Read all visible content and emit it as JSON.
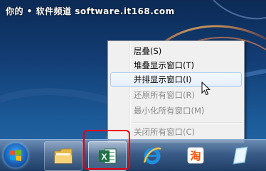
{
  "desktop": {
    "watermark": "你的 • 软件频道 software.it168.com"
  },
  "context_menu": {
    "items": [
      {
        "label": "层叠(S)",
        "state": "normal"
      },
      {
        "label": "堆叠显示窗口(T)",
        "state": "normal"
      },
      {
        "label": "并排显示窗口(I)",
        "state": "hover"
      },
      {
        "label": "还原所有窗口(R)",
        "state": "disabled"
      },
      {
        "label": "最小化所有窗口(M)",
        "state": "disabled"
      },
      {
        "label": "关闭所有窗口(C)",
        "state": "disabled"
      }
    ]
  },
  "taskbar": {
    "buttons": [
      {
        "name": "start-orb",
        "icon": "windows-logo-icon"
      },
      {
        "name": "explorer",
        "icon": "folder-icon"
      },
      {
        "name": "excel",
        "icon": "excel-icon"
      },
      {
        "name": "internet-explorer",
        "icon": "ie-icon"
      },
      {
        "name": "taobao",
        "icon": "taobao-icon",
        "glyph": "淘"
      },
      {
        "name": "notepad",
        "icon": "notepad-icon"
      }
    ],
    "excel_glyph": "X"
  },
  "colors": {
    "highlight": "#e60012",
    "menu_hover": "#aac8ed",
    "excel_green": "#1e7145"
  }
}
